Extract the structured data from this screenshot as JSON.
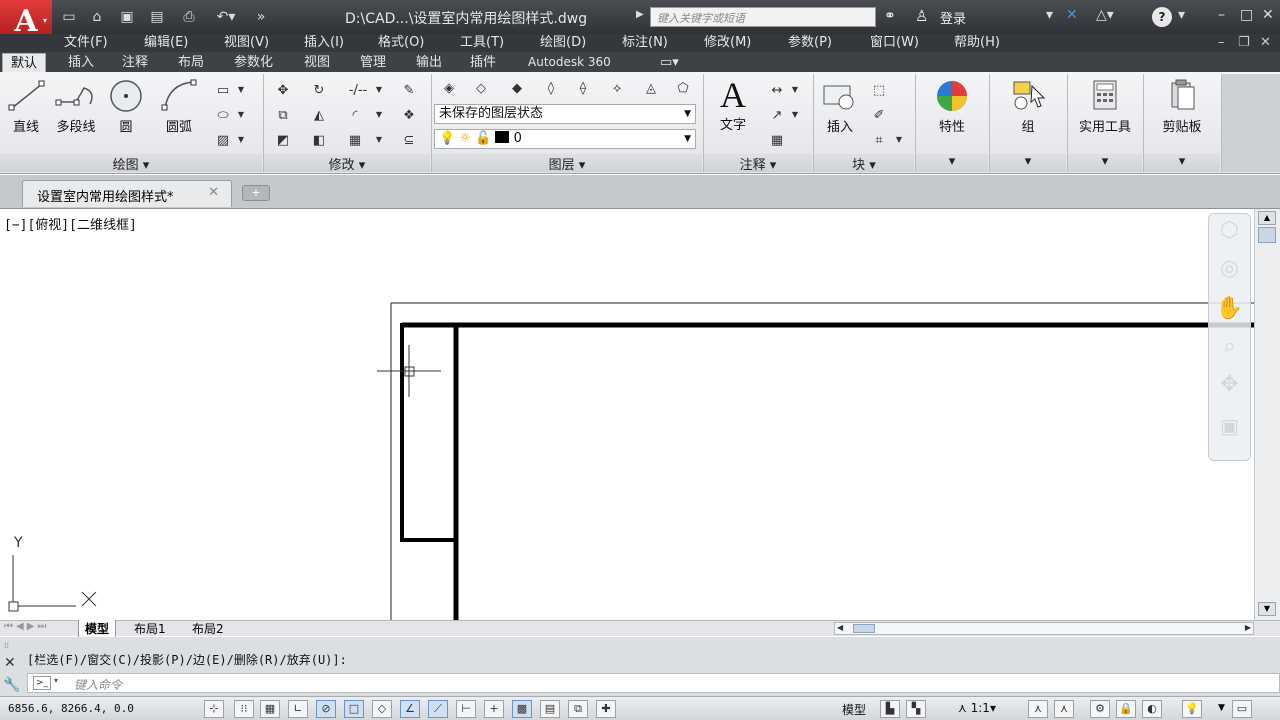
{
  "titlebar": {
    "logo_letter": "A",
    "window_title": "D:\\CAD...\\设置室内常用绘图样式.dwg",
    "search_placeholder": "键入关键字或短语",
    "login_label": "登录",
    "help_label": "?"
  },
  "menubar": [
    "文件(F)",
    "编辑(E)",
    "视图(V)",
    "插入(I)",
    "格式(O)",
    "工具(T)",
    "绘图(D)",
    "标注(N)",
    "修改(M)",
    "参数(P)",
    "窗口(W)",
    "帮助(H)"
  ],
  "ribbon_tabs": [
    "默认",
    "插入",
    "注释",
    "布局",
    "参数化",
    "视图",
    "管理",
    "输出",
    "插件",
    "Autodesk 360"
  ],
  "ribbon": {
    "draw": {
      "title": "绘图",
      "line": "直线",
      "polyline": "多段线",
      "circle": "圆",
      "arc": "圆弧"
    },
    "modify": {
      "title": "修改"
    },
    "layers": {
      "title": "图层",
      "state": "未保存的图层状态",
      "current_layer": "0"
    },
    "annotation": {
      "title": "注释",
      "text": "文字"
    },
    "block": {
      "title": "块",
      "insert": "插入"
    },
    "properties": "特性",
    "groups": "组",
    "utilities": "实用工具",
    "clipboard": "剪贴板"
  },
  "doc_tab": "设置室内常用绘图样式*",
  "viewport_label": "[−][俯视][二维线框]",
  "ucs": {
    "y": "Y",
    "x": "X"
  },
  "layout_tabs": [
    "模型",
    "布局1",
    "布局2"
  ],
  "command": {
    "history": "[栏选(F)/窗交(C)/投影(P)/边(E)/删除(R)/放弃(U)]:",
    "placeholder": "键入命令"
  },
  "status": {
    "coords": "6856.6, 8266.4, 0.0",
    "model": "模型",
    "scale": "1:1"
  },
  "colors": {
    "accent": "#c71d1d",
    "title_bg": "#3a3d41",
    "ribbon_bg": "#eceef0"
  }
}
